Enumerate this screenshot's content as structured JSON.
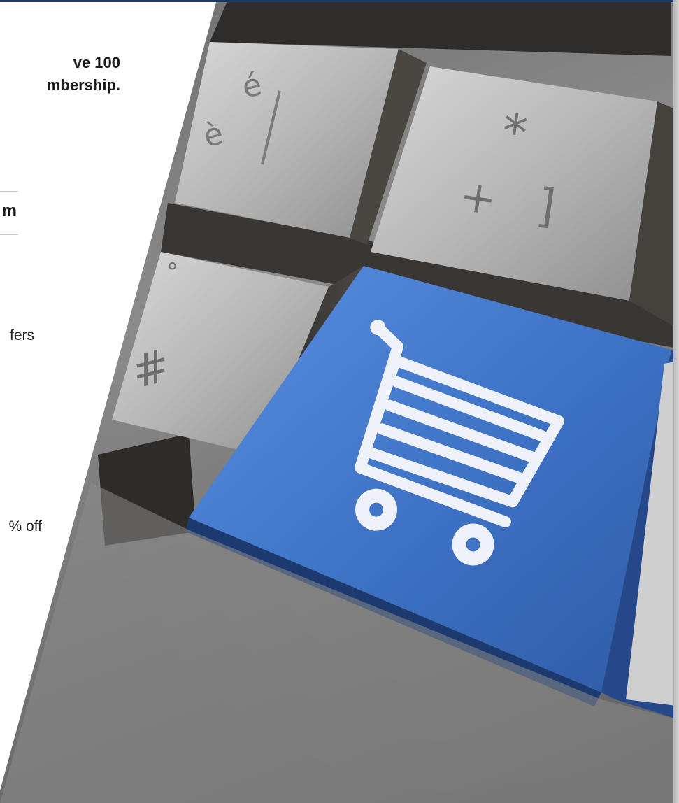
{
  "content": {
    "headline": "ve 100\nmbership.",
    "tab_label": "m",
    "paragraph_1": "fers",
    "paragraph_2": "% off"
  },
  "photo": {
    "subject": "keyboard with blue shopping cart key",
    "key_symbols": {
      "top_left": "é\nè",
      "bar": "|",
      "asterisk_plus": "*\n+ ]",
      "degree": "°",
      "hash": "#"
    }
  },
  "colors": {
    "accent_bar": "#1f3a66",
    "cart_key_blue": "#3f74c7",
    "text": "#1b1b1b"
  }
}
